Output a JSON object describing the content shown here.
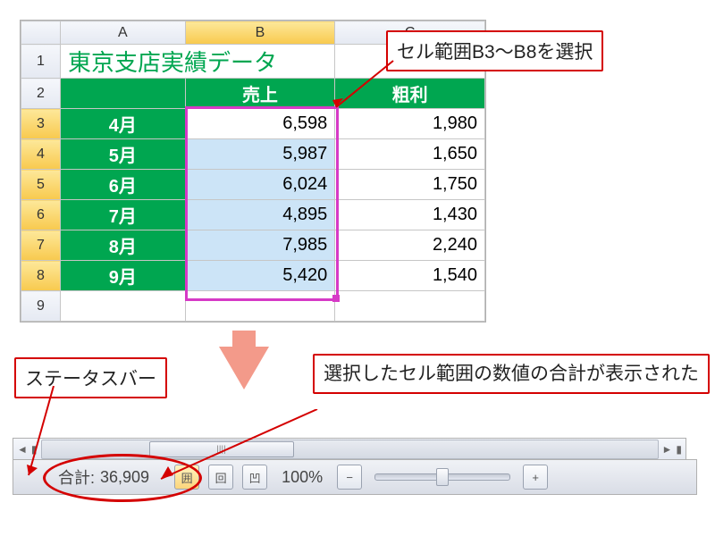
{
  "columns": [
    "",
    "A",
    "B",
    "C"
  ],
  "rows": [
    {
      "n": "1",
      "a": "東京支店実績データ",
      "b": "",
      "c": ""
    },
    {
      "n": "2",
      "a": "",
      "b": "売上",
      "c": "粗利"
    },
    {
      "n": "3",
      "a": "4月",
      "b": "6,598",
      "c": "1,980"
    },
    {
      "n": "4",
      "a": "5月",
      "b": "5,987",
      "c": "1,650"
    },
    {
      "n": "5",
      "a": "6月",
      "b": "6,024",
      "c": "1,750"
    },
    {
      "n": "6",
      "a": "7月",
      "b": "4,895",
      "c": "1,430"
    },
    {
      "n": "7",
      "a": "8月",
      "b": "7,985",
      "c": "2,240"
    },
    {
      "n": "8",
      "a": "9月",
      "b": "5,420",
      "c": "1,540"
    },
    {
      "n": "9",
      "a": "",
      "b": "",
      "c": ""
    }
  ],
  "callouts": {
    "top": "セル範囲B3～B8を選択",
    "left": "ステータスバー",
    "right": "選択したセル範囲の数値の合計が表示された"
  },
  "status": {
    "sum_label": "合計:",
    "sum_value": "36,909",
    "zoom": "100%"
  },
  "icons": {
    "normal": "囲",
    "layout": "回",
    "break": "凹",
    "minus": "−",
    "plus": "+",
    "left": "◄",
    "right": "►",
    "bar": "▮"
  },
  "chart_data": {
    "type": "table",
    "title": "東京支店実績データ",
    "series": [
      {
        "name": "売上",
        "values": [
          6598,
          5987,
          6024,
          4895,
          7985,
          5420
        ]
      },
      {
        "name": "粗利",
        "values": [
          1980,
          1650,
          1750,
          1430,
          2240,
          1540
        ]
      }
    ],
    "categories": [
      "4月",
      "5月",
      "6月",
      "7月",
      "8月",
      "9月"
    ],
    "sum_売上": 36909
  }
}
